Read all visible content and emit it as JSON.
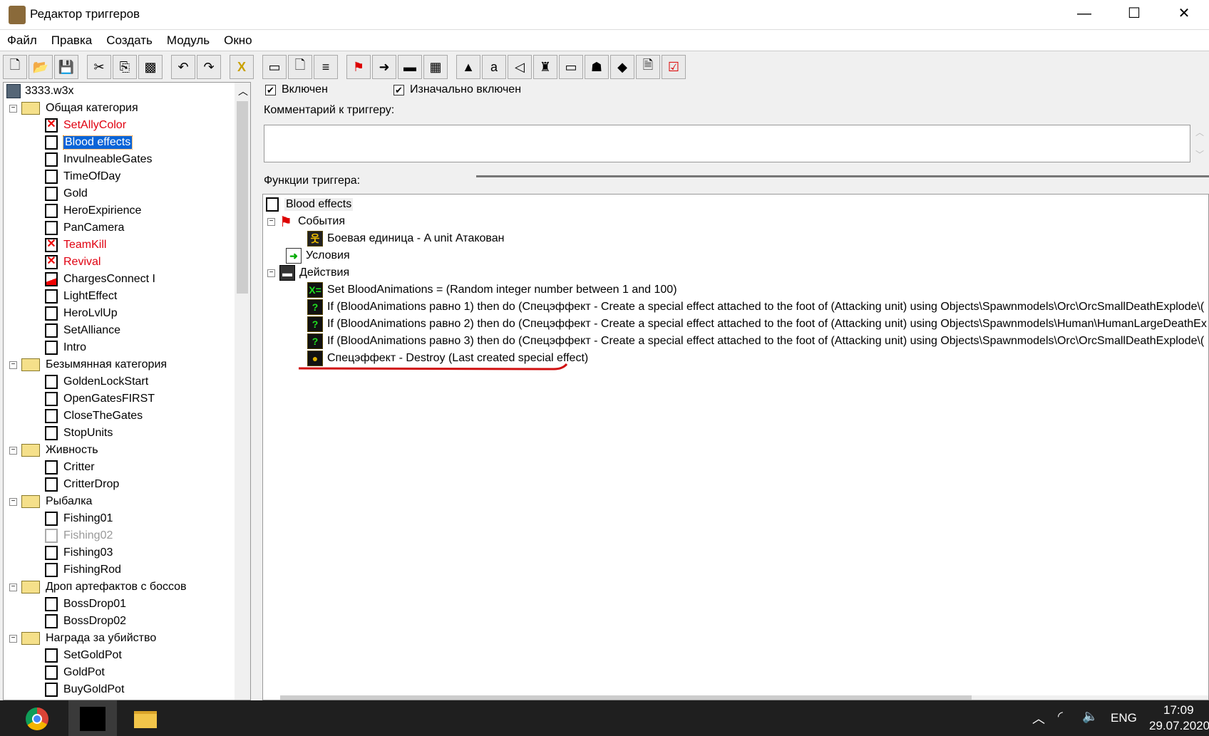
{
  "window": {
    "title": "Редактор триггеров",
    "minimize": "—",
    "maximize": "☐",
    "close": "✕"
  },
  "menu": [
    "Файл",
    "Правка",
    "Создать",
    "Модуль",
    "Окно"
  ],
  "toolbar_icons": [
    "new",
    "open",
    "save",
    "cut",
    "copy",
    "paste",
    "undo",
    "redo",
    "delete",
    "new-category",
    "new-trigger",
    "new-comment",
    "event",
    "condition",
    "action",
    "variables",
    "terrain",
    "text",
    "sound",
    "unit",
    "object",
    "ai",
    "import",
    "new-file",
    "test"
  ],
  "tree": {
    "root": "3333.w3x",
    "categories": [
      {
        "name": "Общая категория",
        "items": [
          {
            "label": "SetAllyColor",
            "state": "disabled"
          },
          {
            "label": "Blood effects",
            "state": "selected"
          },
          {
            "label": "InvulneableGates",
            "state": "normal"
          },
          {
            "label": "TimeOfDay",
            "state": "normal"
          },
          {
            "label": "Gold",
            "state": "normal"
          },
          {
            "label": "HeroExpirience",
            "state": "normal"
          },
          {
            "label": "PanCamera",
            "state": "normal"
          },
          {
            "label": "TeamKill",
            "state": "disabled"
          },
          {
            "label": "Revival",
            "state": "disabled"
          },
          {
            "label": "ChargesConnect I",
            "state": "partial"
          },
          {
            "label": "LightEffect",
            "state": "normal"
          },
          {
            "label": "HeroLvlUp",
            "state": "normal"
          },
          {
            "label": "SetAlliance",
            "state": "normal"
          },
          {
            "label": "Intro",
            "state": "normal"
          }
        ]
      },
      {
        "name": "Безымянная категория",
        "items": [
          {
            "label": "GoldenLockStart",
            "state": "normal"
          },
          {
            "label": "OpenGatesFIRST",
            "state": "normal"
          },
          {
            "label": "CloseTheGates",
            "state": "normal"
          },
          {
            "label": "StopUnits",
            "state": "normal"
          }
        ]
      },
      {
        "name": "Живность",
        "items": [
          {
            "label": "Critter",
            "state": "normal"
          },
          {
            "label": "CritterDrop",
            "state": "normal"
          }
        ]
      },
      {
        "name": "Рыбалка",
        "items": [
          {
            "label": "Fishing01",
            "state": "normal"
          },
          {
            "label": "Fishing02",
            "state": "off"
          },
          {
            "label": "Fishing03",
            "state": "normal"
          },
          {
            "label": "FishingRod",
            "state": "normal"
          }
        ]
      },
      {
        "name": "Дроп артефактов с боссов",
        "items": [
          {
            "label": "BossDrop01",
            "state": "normal"
          },
          {
            "label": "BossDrop02",
            "state": "normal"
          }
        ]
      },
      {
        "name": "Награда за убийство",
        "items": [
          {
            "label": "SetGoldPot",
            "state": "normal"
          },
          {
            "label": "GoldPot",
            "state": "normal"
          },
          {
            "label": "BuyGoldPot",
            "state": "normal"
          }
        ]
      }
    ]
  },
  "trigger": {
    "enabled_label": "Включен",
    "enabled": true,
    "initially_on_label": "Изначально включен",
    "initially_on": true,
    "comment_label": "Комментарий к триггеру:",
    "comment": "",
    "functions_label": "Функции триггера:",
    "name": "Blood effects",
    "events_label": "События",
    "events": [
      "Боевая единица - A unit Атакован"
    ],
    "conditions_label": "Условия",
    "actions_label": "Действия",
    "actions": [
      {
        "icon": "set-variable",
        "text": "Set BloodAnimations = (Random integer number between 1 and 100)"
      },
      {
        "icon": "if",
        "text": "If (BloodAnimations равно 1) then do (Спецэффект - Create a special effect attached to the foot of (Attacking unit) using Objects\\Spawnmodels\\Orc\\OrcSmallDeathExplode\\("
      },
      {
        "icon": "if",
        "text": "If (BloodAnimations равно 2) then do (Спецэффект - Create a special effect attached to the foot of (Attacking unit) using Objects\\Spawnmodels\\Human\\HumanLargeDeathEx"
      },
      {
        "icon": "if",
        "text": "If (BloodAnimations равно 3) then do (Спецэффект - Create a special effect attached to the foot of (Attacking unit) using Objects\\Spawnmodels\\Orc\\OrcSmallDeathExplode\\("
      },
      {
        "icon": "effect",
        "text": "Спецэффект - Destroy (Last created special effect)"
      }
    ]
  },
  "taskbar": {
    "lang": "ENG",
    "time": "17:09",
    "date": "29.07.2020"
  },
  "colors": {
    "disabled": "#e00010",
    "selection": "#0a64d8",
    "annotation": "#d01010"
  }
}
